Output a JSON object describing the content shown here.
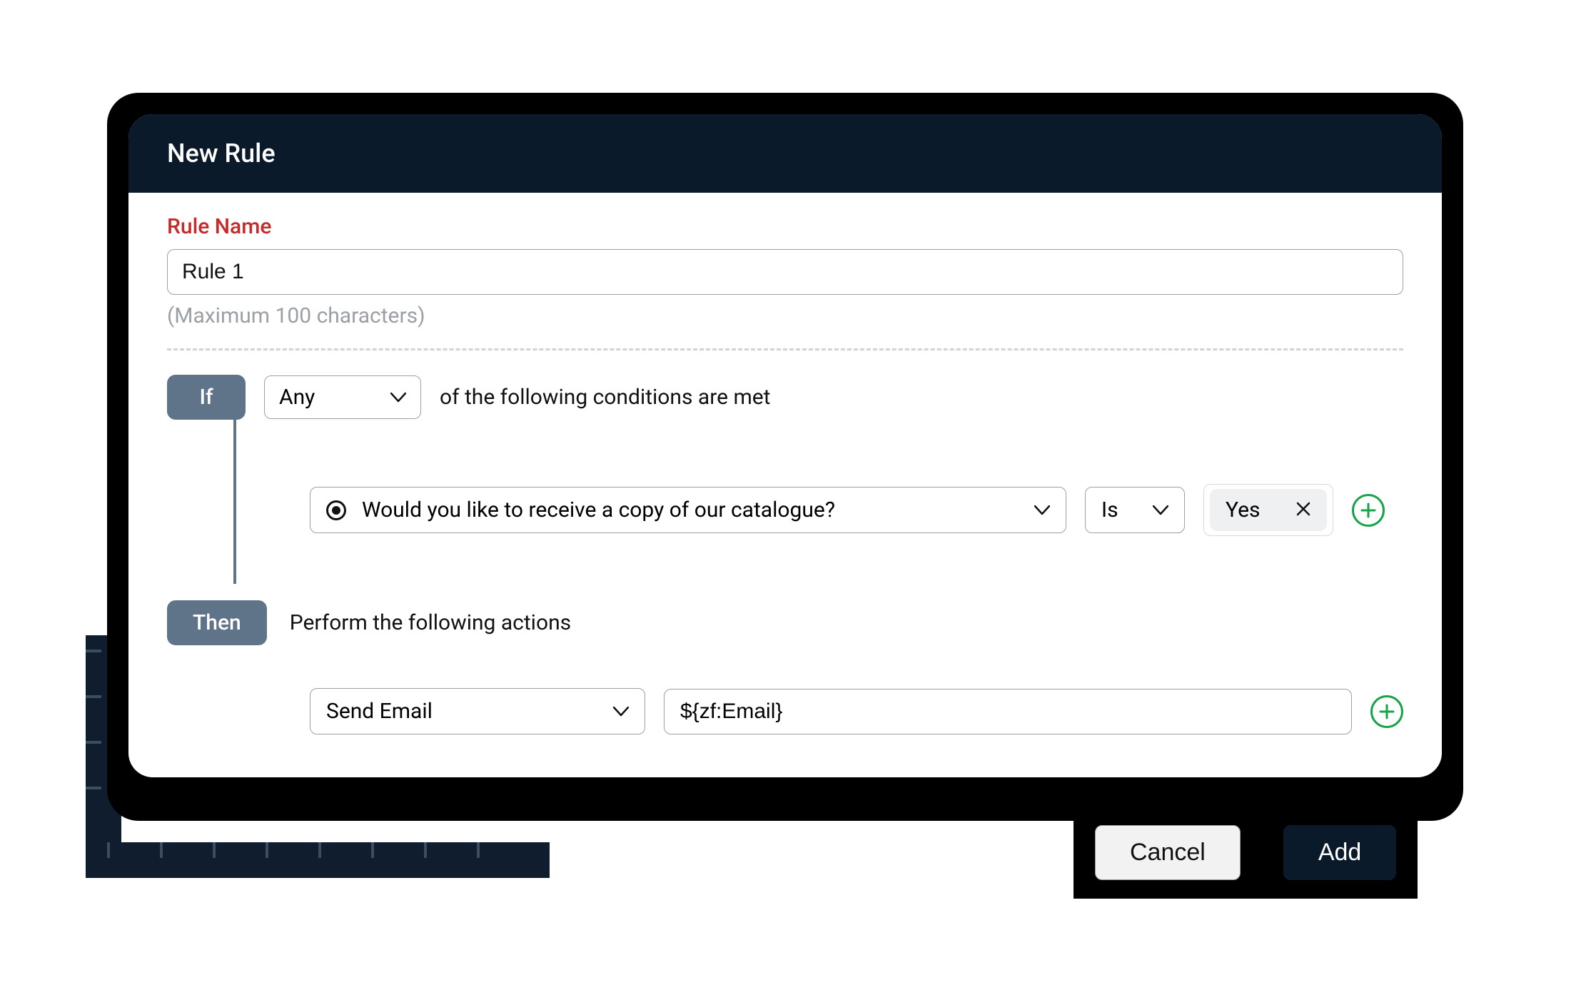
{
  "dialog": {
    "title": "New Rule",
    "ruleName": {
      "label": "Rule Name",
      "value": "Rule 1",
      "helper": "(Maximum 100 characters)"
    },
    "if": {
      "pill": "If",
      "mode": "Any",
      "suffix": "of the following conditions are met",
      "condition": {
        "field": "Would you like to receive a copy of our catalogue?",
        "operator": "Is",
        "value": "Yes"
      }
    },
    "then": {
      "pill": "Then",
      "label": "Perform the following actions",
      "action": {
        "type": "Send Email",
        "value": "${zf:Email}"
      }
    },
    "buttons": {
      "cancel": "Cancel",
      "add": "Add"
    }
  }
}
